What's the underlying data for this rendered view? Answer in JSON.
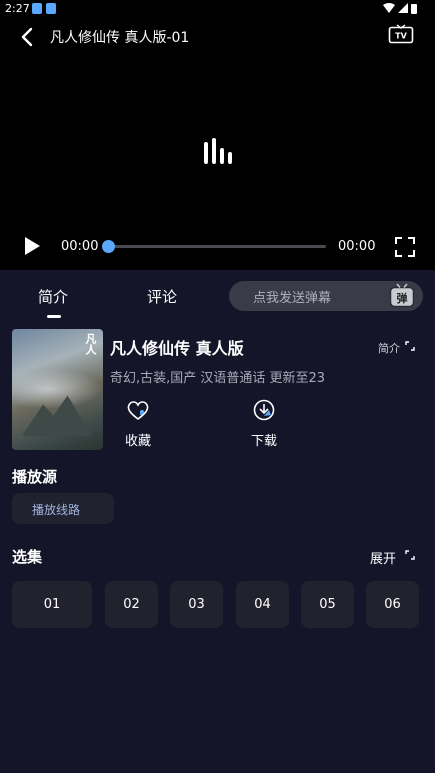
{
  "status_bar": {
    "time": "2:27"
  },
  "player": {
    "title": "凡人修仙传 真人版-01",
    "current_time": "00:00",
    "duration": "00:00",
    "progress": 0.0,
    "tv_label": "TV"
  },
  "tabs": [
    {
      "label": "简介",
      "active": true
    },
    {
      "label": "评论",
      "active": false
    }
  ],
  "danmu": {
    "placeholder": "点我发送弹幕",
    "button_label": "弹"
  },
  "show": {
    "name": "凡人修仙传 真人版",
    "intro_label": "简介",
    "meta": "奇幻,古装,国产 汉语普通话 更新至23",
    "poster_caption": "凡人"
  },
  "actions": {
    "favorite_label": "收藏",
    "download_label": "下载"
  },
  "sources": {
    "heading": "播放源",
    "current": "播放线路"
  },
  "episodes": {
    "heading": "选集",
    "expand_label": "展开",
    "items": [
      "01",
      "02",
      "03",
      "04",
      "05",
      "06"
    ]
  },
  "colors": {
    "accent": "#5aa9ff",
    "background": "#15152a",
    "chip": "#22222f"
  }
}
